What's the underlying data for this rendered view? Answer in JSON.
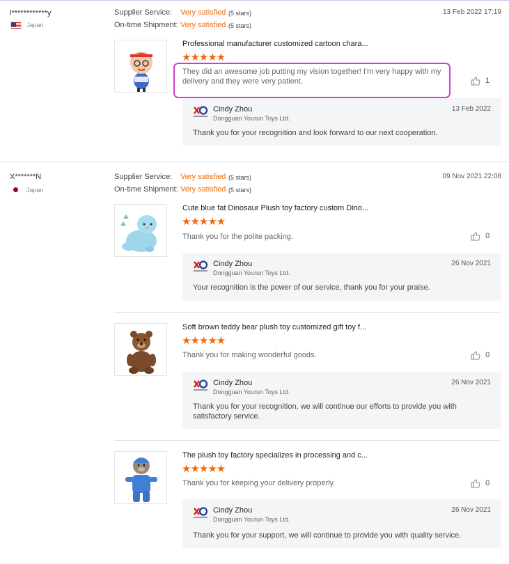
{
  "reviews": [
    {
      "user": "l************y",
      "country": "Japan",
      "supplier_label": "Supplier Service:",
      "supplier_value": "Very satisfied",
      "supplier_stars": "(5 stars)",
      "shipment_label": "On-time Shipment:",
      "shipment_value": "Very satisfied",
      "shipment_stars": "(5 stars)",
      "date": "13 Feb 2022 17:19",
      "items": [
        {
          "title": "Professional manufacturer customized cartoon chara...",
          "stars": "★★★★★",
          "text": "They did an awesome job putting my vision together! I'm very happy with my delivery and they were very patient.",
          "likes": "1",
          "reply": {
            "name": "Cindy Zhou",
            "company": "Dongguan Yourun Toys Ltd.",
            "date": "13 Feb 2022",
            "text": "Thank you for your recognition and look forward to our next cooperation."
          }
        }
      ]
    },
    {
      "user": "X*******N",
      "country": "Japan",
      "supplier_label": "Supplier Service:",
      "supplier_value": "Very satisfied",
      "supplier_stars": "(5 stars)",
      "shipment_label": "On-time Shipment:",
      "shipment_value": "Very satisfied",
      "shipment_stars": "(5 stars)",
      "date": "09 Nov 2021 22:08",
      "items": [
        {
          "title": "Cute blue fat Dinosaur Plush toy factory custom Dino...",
          "stars": "★★★★★",
          "text": "Thank you for the polite packing.",
          "likes": "0",
          "reply": {
            "name": "Cindy Zhou",
            "company": "Dongguan Yourun Toys Ltd.",
            "date": "26 Nov 2021",
            "text": "Your recognition is the power of our service, thank you for your praise."
          }
        },
        {
          "title": "Soft brown teddy bear plush toy customized gift toy f...",
          "stars": "★★★★★",
          "text": "Thank you for making wonderful goods.",
          "likes": "0",
          "reply": {
            "name": "Cindy Zhou",
            "company": "Dongguan Yourun Toys Ltd.",
            "date": "26 Nov 2021",
            "text": "Thank you for your recognition, we will continue our efforts to provide you with satisfactory service."
          }
        },
        {
          "title": "The plush toy factory specializes in processing and c...",
          "stars": "★★★★★",
          "text": "Thank you for keeping your delivery properly.",
          "likes": "0",
          "reply": {
            "name": "Cindy Zhou",
            "company": "Dongguan Yourun Toys Ltd.",
            "date": "26 Nov 2021",
            "text": "Thank you for your support, we will continue to provide you with quality service."
          }
        }
      ]
    }
  ],
  "colors": {
    "accent": "#ef6a0a",
    "highlight": "#d63ad6",
    "reply_bg": "#f4f5f7"
  },
  "icons": {
    "like": "thumbs-up-icon",
    "flag_1": "us-flag-icon",
    "flag_2": "japan-flag-icon"
  }
}
